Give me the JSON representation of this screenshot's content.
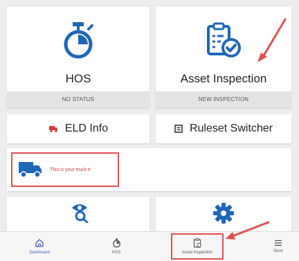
{
  "tiles": {
    "hos": {
      "label": "HOS",
      "status": "NO STATUS",
      "icon": "stopwatch-icon"
    },
    "asset": {
      "label": "Asset Inspection",
      "status": "NEW INSPECTION",
      "icon": "clipboard-check-icon"
    }
  },
  "buttons": {
    "eld": {
      "label": "ELD Info",
      "icon": "truck-small-icon"
    },
    "ruleset": {
      "label": "Ruleset Switcher",
      "icon": "ruleset-icon"
    }
  },
  "truck": {
    "text": "This is your truck #",
    "icon": "truck-icon"
  },
  "lower_tiles": [
    {
      "icon": "eye-search-icon"
    },
    {
      "icon": "gear-icon"
    }
  ],
  "nav": {
    "items": [
      {
        "label": "Dashboard",
        "icon": "home-icon"
      },
      {
        "label": "HOS",
        "icon": "stopwatch-icon"
      },
      {
        "label": "Asset Inspection",
        "icon": "clipboard-icon"
      },
      {
        "label": "More",
        "icon": "menu-icon"
      }
    ]
  },
  "colors": {
    "primary": "#1f67b8",
    "annotation_red": "#e05050",
    "background": "#ededed"
  }
}
